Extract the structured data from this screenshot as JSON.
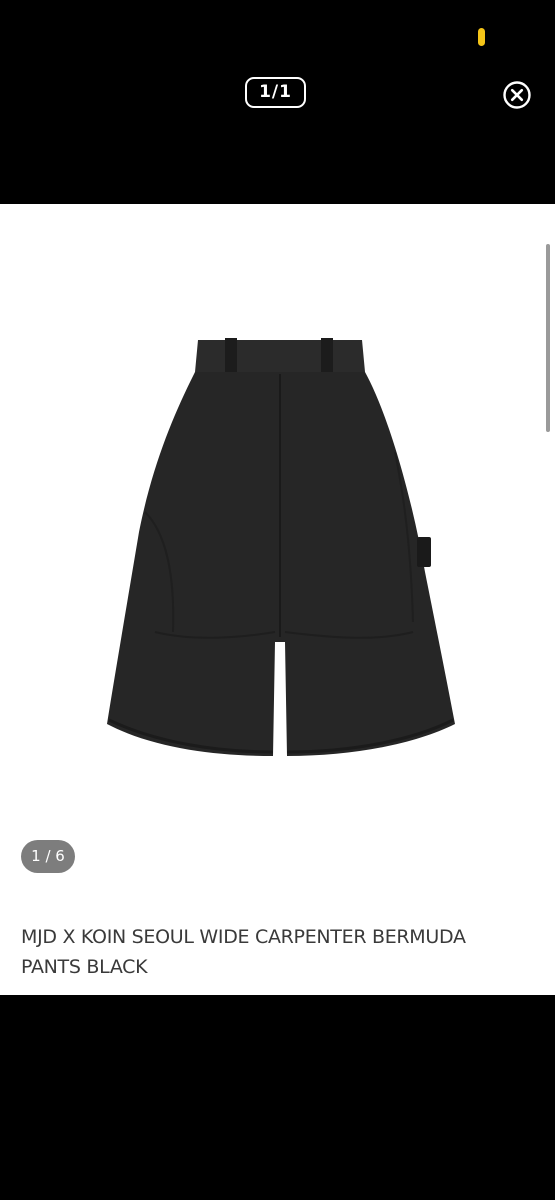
{
  "viewer": {
    "page_counter": "1/1",
    "close_icon": "close-circle-icon"
  },
  "product": {
    "image_counter": "1 / 6",
    "title": "MJD X KOIN SEOUL WIDE CARPENTER BERMUDA PANTS BLACK"
  },
  "colors": {
    "background": "#000000",
    "content_background": "#ffffff",
    "status_indicator": "#f5c518",
    "counter_pill": "#7d7d7d",
    "title_text": "#3a3a3a"
  }
}
